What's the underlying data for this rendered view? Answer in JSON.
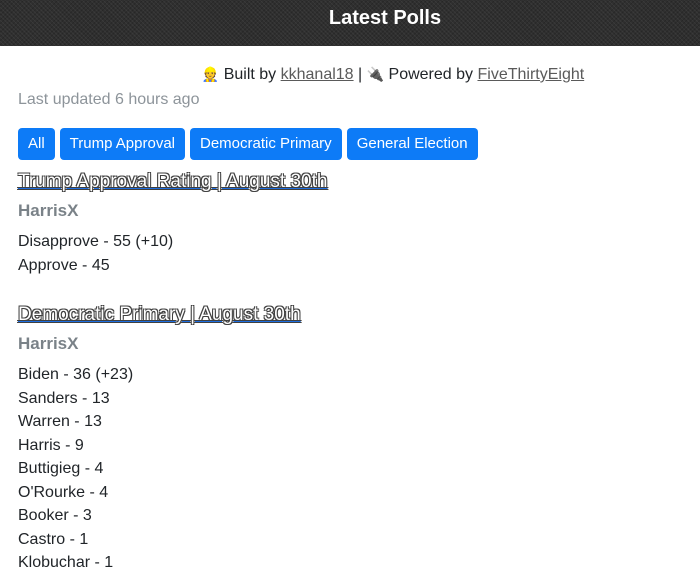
{
  "header": {
    "title": "Latest Polls"
  },
  "credits": {
    "builder_emoji": "👷",
    "built_by_text": "Built by",
    "builder_link": "kkhanal18",
    "separator": "|",
    "power_emoji": "🔌",
    "powered_by_text": "Powered by",
    "source_link": "FiveThirtyEight"
  },
  "updated": "Last updated 6 hours ago",
  "filters": [
    "All",
    "Trump Approval",
    "Democratic Primary",
    "General Election"
  ],
  "polls": [
    {
      "title": "Trump Approval Rating | August 30th",
      "pollster": "HarrisX",
      "results": [
        "Disapprove - 55 (+10)",
        "Approve - 45"
      ]
    },
    {
      "title": "Democratic Primary | August 30th",
      "pollster": "HarrisX",
      "results": [
        "Biden - 36 (+23)",
        "Sanders - 13",
        "Warren - 13",
        "Harris - 9",
        "Buttigieg - 4",
        "O'Rourke - 4",
        "Booker - 3",
        "Castro - 1",
        "Klobuchar - 1"
      ]
    }
  ],
  "colors": {
    "accent": "#0d7bf7",
    "header_bg": "#2f2f2f",
    "muted": "#8d949a"
  }
}
